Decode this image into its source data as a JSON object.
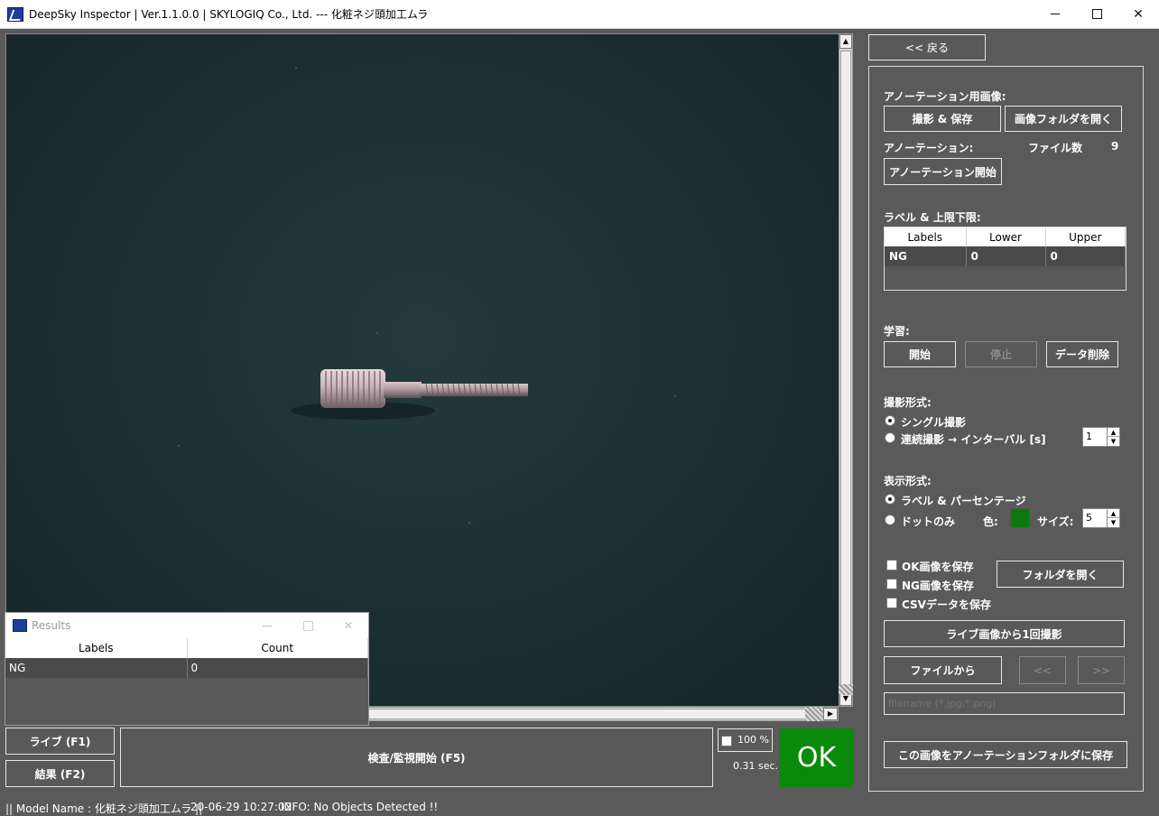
{
  "window": {
    "title": "DeepSky Inspector | Ver.1.1.0.0 | SKYLOGIQ Co., Ltd. --- 化粧ネジ頭加工ムラ"
  },
  "results_window": {
    "title": "Results",
    "columns": [
      "Labels",
      "Count"
    ],
    "rows": [
      {
        "label": "NG",
        "count": "0"
      }
    ]
  },
  "bottom": {
    "live_button": "ライブ (F1)",
    "result_button": "結果 (F2)",
    "inspect_button": "検査/監視開始 (F5)",
    "zoom_label": "100 %",
    "time_label": "0.31 sec.",
    "judgement": "OK",
    "judgement_color": "#0a8a0a"
  },
  "status": {
    "model": "|| Model Name : 化粧ネジ頭加工ムラ ||",
    "datetime": "20-06-29 10:27:02",
    "info": "INFO:   No Objects Detected !!"
  },
  "panel": {
    "back_button": "<< 戻る",
    "annotation_image_label": "アノーテーション用画像:",
    "capture_save_button": "撮影 & 保存",
    "open_image_folder_button": "画像フォルダを開く",
    "annotation_label": "アノーテーション:",
    "file_count_label": "ファイル数",
    "file_count": "9",
    "annotation_start_button": "アノーテーション開始",
    "labels_limits_label": "ラベル & 上限下限:",
    "limits_columns": [
      "Labels",
      "Lower",
      "Upper"
    ],
    "limits_rows": [
      {
        "label": "NG",
        "lower": "0",
        "upper": "0"
      }
    ],
    "training_label": "学習:",
    "train_start_button": "開始",
    "train_stop_button": "停止",
    "delete_data_button": "データ削除",
    "capture_mode_label": "撮影形式:",
    "single_capture": "シングル撮影",
    "continuous_capture": "連続撮影 → インターバル [s]",
    "interval_value": "1",
    "display_mode_label": "表示形式:",
    "display_label_percent": "ラベル & パーセンテージ",
    "display_dot_only": "ドットのみ",
    "color_label": "色:",
    "dot_color": "#0a7a0a",
    "size_label": "サイズ:",
    "size_value": "5",
    "save_ok_images": "OK画像を保存",
    "save_ng_images": "NG画像を保存",
    "save_csv": "CSVデータを保存",
    "open_folder_button": "フォルダを開く",
    "capture_once_button": "ライブ画像から1回撮影",
    "from_file_button": "ファイルから",
    "prev_button": "<<",
    "next_button": ">>",
    "filename_placeholder": "filename (*.jpg,*.png)",
    "save_to_annotation_button": "この画像をアノーテーションフォルダに保存"
  }
}
